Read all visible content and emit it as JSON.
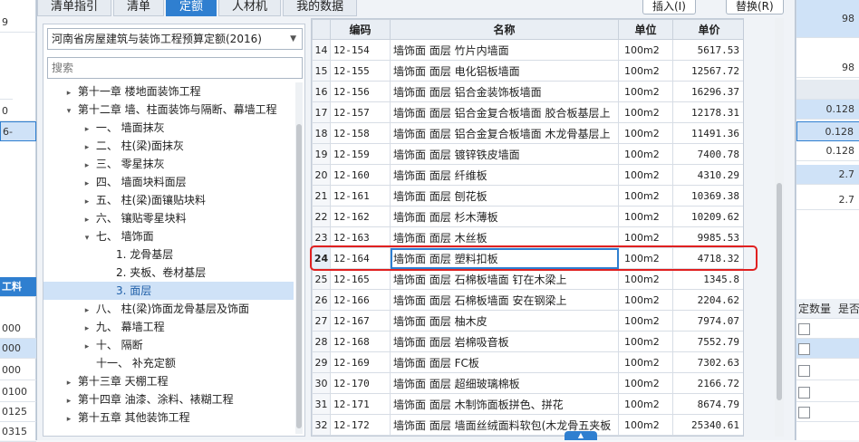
{
  "background": {
    "left_cells": [
      "9",
      "0",
      "",
      "0",
      "6-",
      "",
      "",
      "工料",
      "000",
      "000",
      "000",
      "0100",
      "0125",
      "0315"
    ],
    "left_expand": "−",
    "right_cells": [
      "98",
      "98",
      "",
      "0.128",
      "0.128",
      "0.128",
      "2.7",
      "2.7"
    ],
    "right_headers": [
      "定数量",
      "是否"
    ]
  },
  "dialog": {
    "tabs": [
      "清单指引",
      "清单",
      "定额",
      "人材机",
      "我的数据"
    ],
    "active_tab": "定额",
    "insert_button": "插入(I)",
    "replace_button": "替换(R)",
    "quota_select": "河南省房屋建筑与装饰工程预算定额(2016)",
    "search_placeholder": "搜索",
    "tree": [
      {
        "label": "第十一章 楼地面装饰工程",
        "toggle": "▸"
      },
      {
        "label": "第十二章 墙、柱面装饰与隔断、幕墙工程",
        "toggle": "▾"
      },
      {
        "label": "一、 墙面抹灰",
        "toggle": "▸"
      },
      {
        "label": "二、 柱(梁)面抹灰",
        "toggle": "▸"
      },
      {
        "label": "三、 零星抹灰",
        "toggle": "▸"
      },
      {
        "label": "四、 墙面块料面层",
        "toggle": "▸"
      },
      {
        "label": "五、 柱(梁)面镶贴块料",
        "toggle": "▸"
      },
      {
        "label": "六、 镶贴零星块料",
        "toggle": "▸"
      },
      {
        "label": "七、 墙饰面",
        "toggle": "▾"
      },
      {
        "label": "1. 龙骨基层",
        "toggle": ""
      },
      {
        "label": "2. 夹板、卷材基层",
        "toggle": ""
      },
      {
        "label": "3. 面层",
        "toggle": ""
      },
      {
        "label": "八、 柱(梁)饰面龙骨基层及饰面",
        "toggle": "▸"
      },
      {
        "label": "九、 幕墙工程",
        "toggle": "▸"
      },
      {
        "label": "十、 隔断",
        "toggle": "▸"
      },
      {
        "label": "十一、 补充定额",
        "toggle": ""
      },
      {
        "label": "第十三章 天棚工程",
        "toggle": "▸"
      },
      {
        "label": "第十四章 油漆、涂料、裱糊工程",
        "toggle": "▸"
      },
      {
        "label": "第十五章 其他装饰工程",
        "toggle": "▸"
      }
    ],
    "grid": {
      "columns": [
        "",
        "编码",
        "名称",
        "单位",
        "单价"
      ],
      "rows": [
        {
          "idx": "14",
          "code": "12-154",
          "name": "墙饰面 面层 竹片内墙面",
          "unit": "100m2",
          "price": "5617.53"
        },
        {
          "idx": "15",
          "code": "12-155",
          "name": "墙饰面 面层 电化铝板墙面",
          "unit": "100m2",
          "price": "12567.72"
        },
        {
          "idx": "16",
          "code": "12-156",
          "name": "墙饰面 面层 铝合金装饰板墙面",
          "unit": "100m2",
          "price": "16296.37"
        },
        {
          "idx": "17",
          "code": "12-157",
          "name": "墙饰面 面层 铝合金复合板墙面 胶合板基层上",
          "unit": "100m2",
          "price": "12178.31"
        },
        {
          "idx": "18",
          "code": "12-158",
          "name": "墙饰面 面层 铝合金复合板墙面 木龙骨基层上",
          "unit": "100m2",
          "price": "11491.36"
        },
        {
          "idx": "19",
          "code": "12-159",
          "name": "墙饰面 面层 镀锌铁皮墙面",
          "unit": "100m2",
          "price": "7400.78"
        },
        {
          "idx": "20",
          "code": "12-160",
          "name": "墙饰面 面层 纤维板",
          "unit": "100m2",
          "price": "4310.29"
        },
        {
          "idx": "21",
          "code": "12-161",
          "name": "墙饰面 面层 刨花板",
          "unit": "100m2",
          "price": "10369.38"
        },
        {
          "idx": "22",
          "code": "12-162",
          "name": "墙饰面 面层 杉木薄板",
          "unit": "100m2",
          "price": "10209.62"
        },
        {
          "idx": "23",
          "code": "12-163",
          "name": "墙饰面 面层 木丝板",
          "unit": "100m2",
          "price": "9985.53"
        },
        {
          "idx": "24",
          "code": "12-164",
          "name": "墙饰面 面层 塑料扣板",
          "unit": "100m2",
          "price": "4718.32"
        },
        {
          "idx": "25",
          "code": "12-165",
          "name": "墙饰面 面层 石棉板墙面 钉在木梁上",
          "unit": "100m2",
          "price": "1345.8"
        },
        {
          "idx": "26",
          "code": "12-166",
          "name": "墙饰面 面层 石棉板墙面 安在钢梁上",
          "unit": "100m2",
          "price": "2204.62"
        },
        {
          "idx": "27",
          "code": "12-167",
          "name": "墙饰面 面层 柚木皮",
          "unit": "100m2",
          "price": "7974.07"
        },
        {
          "idx": "28",
          "code": "12-168",
          "name": "墙饰面 面层 岩棉吸音板",
          "unit": "100m2",
          "price": "7552.79"
        },
        {
          "idx": "29",
          "code": "12-169",
          "name": "墙饰面 面层 FC板",
          "unit": "100m2",
          "price": "7302.63"
        },
        {
          "idx": "30",
          "code": "12-170",
          "name": "墙饰面 面层 超细玻璃棉板",
          "unit": "100m2",
          "price": "2166.72"
        },
        {
          "idx": "31",
          "code": "12-171",
          "name": "墙饰面 面层 木制饰面板拼色、拼花",
          "unit": "100m2",
          "price": "8674.79"
        },
        {
          "idx": "32",
          "code": "12-172",
          "name": "墙饰面 面层 墙面丝绒面料软包(木龙骨五夹板",
          "unit": "100m2",
          "price": "25340.61"
        }
      ],
      "selected_index": "24"
    }
  }
}
